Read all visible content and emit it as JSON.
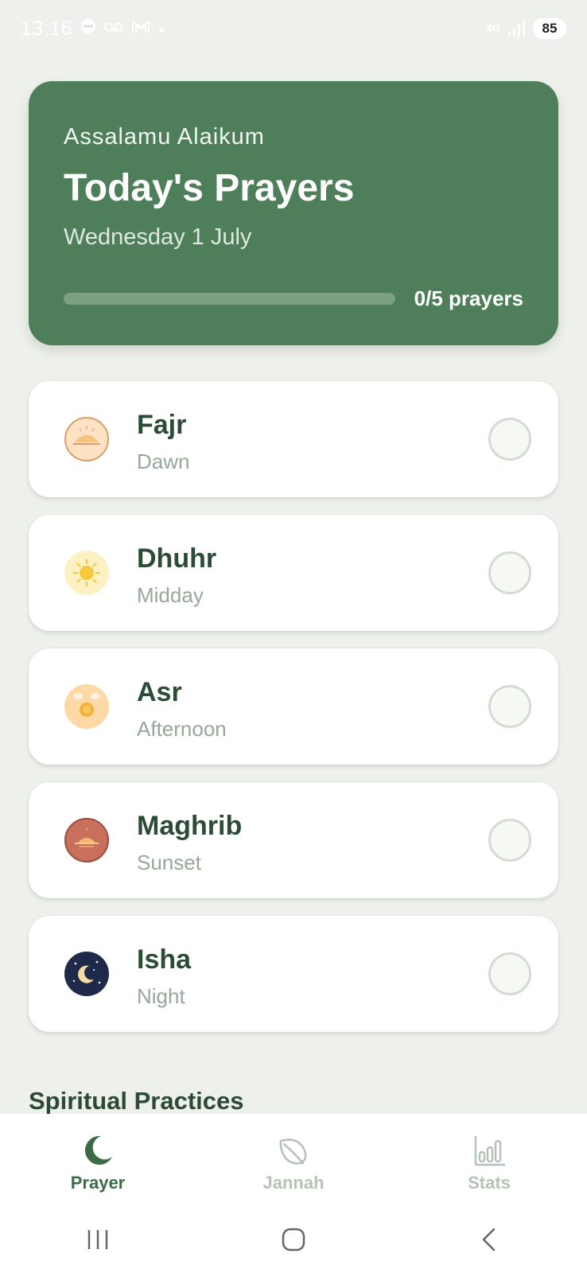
{
  "status_bar": {
    "time": "13:16",
    "network": "4G",
    "battery": "85"
  },
  "header": {
    "greeting": "Assalamu Alaikum",
    "title": "Today's Prayers",
    "date": "Wednesday 1 July",
    "progress_text": "0/5 prayers",
    "progress_fraction": 0
  },
  "prayers": [
    {
      "name": "Fajr",
      "subtitle": "Dawn",
      "icon": "dawn-icon",
      "completed": false
    },
    {
      "name": "Dhuhr",
      "subtitle": "Midday",
      "icon": "sun-icon",
      "completed": false
    },
    {
      "name": "Asr",
      "subtitle": "Afternoon",
      "icon": "afternoon-sun-icon",
      "completed": false
    },
    {
      "name": "Maghrib",
      "subtitle": "Sunset",
      "icon": "sunset-icon",
      "completed": false
    },
    {
      "name": "Isha",
      "subtitle": "Night",
      "icon": "moon-night-icon",
      "completed": false
    }
  ],
  "section_title": "Spiritual Practices",
  "bottom_nav": [
    {
      "label": "Prayer",
      "icon": "crescent-moon-icon",
      "active": true
    },
    {
      "label": "Jannah",
      "icon": "leaf-icon",
      "active": false
    },
    {
      "label": "Stats",
      "icon": "bar-chart-icon",
      "active": false
    }
  ],
  "colors": {
    "accent": "#4f7f5a",
    "background": "#eef0eb",
    "text_dark": "#2c4a36",
    "text_muted": "#97a89a"
  }
}
